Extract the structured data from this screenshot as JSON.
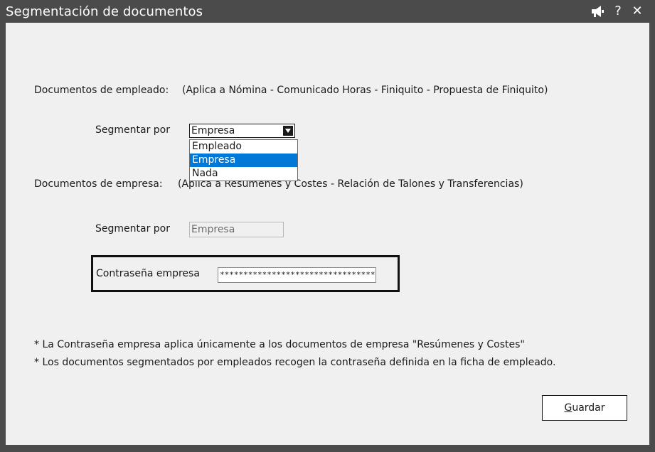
{
  "window": {
    "title": "Segmentación de documentos"
  },
  "titlebar_icons": [
    "megaphone-icon",
    "help-icon",
    "close-icon"
  ],
  "titlebar": {
    "help_glyph": "?",
    "close_glyph": "✕"
  },
  "employee_docs": {
    "label": "Documentos de empleado:",
    "applies": "(Aplica a Nómina - Comunicado Horas - Finiquito - Propuesta de Finiquito)",
    "segment_label": "Segmentar por",
    "selected": "Empresa",
    "options": [
      "Empleado",
      "Empresa",
      "Nada"
    ],
    "highlighted_option": "Empresa"
  },
  "company_docs": {
    "label": "Documentos de empresa:",
    "applies": "(Aplica a Resúmenes y Costes - Relación de Talones y Transferencias)",
    "segment_label": "Segmentar por",
    "segment_value": "Empresa",
    "password_label": "Contraseña empresa",
    "password_value": "************************************"
  },
  "notes": [
    "* La Contraseña empresa aplica únicamente a los documentos de empresa \"Resúmenes y Costes\"",
    "* Los documentos segmentados por empleados recogen la contraseña definida en la ficha de empleado."
  ],
  "save_button": {
    "accel": "G",
    "rest": "uardar"
  },
  "colors": {
    "titlebar": "#4b4b4b",
    "client": "#f0f0f0",
    "selection": "#0078d7"
  }
}
